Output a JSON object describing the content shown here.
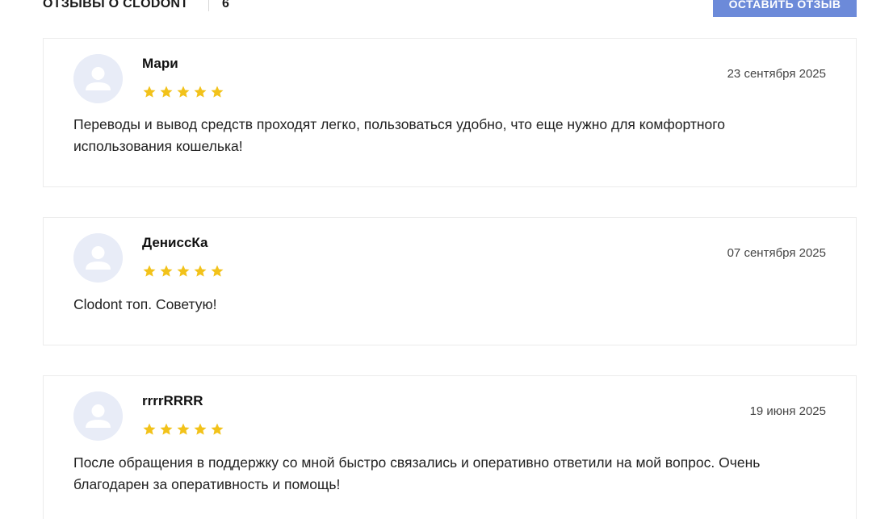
{
  "header": {
    "title": "Отзывы о Clodont",
    "count": "6",
    "leave_review_label": "Оставить отзыв"
  },
  "colors": {
    "accent": "#6c8ad9",
    "star": "#f2c21a",
    "avatar_bg": "#e8ecf7"
  },
  "reviews": [
    {
      "author": "Мари",
      "date": "23 сентября 2025",
      "rating": 5,
      "text": "Переводы и вывод средств проходят легко, пользоваться удобно, что еще нужно для комфортного использования кошелька!"
    },
    {
      "author": "ДениссКа",
      "date": "07 сентября 2025",
      "rating": 5,
      "text": "Clodont топ. Советую!"
    },
    {
      "author": "rrrrRRRR",
      "date": "19 июня 2025",
      "rating": 5,
      "text": "После обращения в поддержку со мной быстро связались и оперативно ответили на мой вопрос. Очень благодарен за оперативность и помощь!"
    }
  ]
}
